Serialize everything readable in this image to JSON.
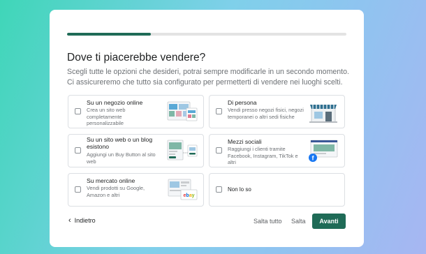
{
  "progress": {
    "value": 0.3
  },
  "header": {
    "title": "Dove ti piacerebbe vendere?",
    "subtitle": "Scegli tutte le opzioni che desideri, potrai sempre modificarle in un secondo momento. Ci assicureremo che tutto sia configurato per permetterti di vendere nei luoghi scelti."
  },
  "options": [
    {
      "title": "Su un negozio online",
      "desc": "Crea un sito web completamente personalizzabile",
      "icon": "online-store-illustration"
    },
    {
      "title": "Di persona",
      "desc": "Vendi presso negozi fisici, negozi temporanei o altri sedi fisiche",
      "icon": "physical-store-illustration"
    },
    {
      "title": "Su un sito web o un blog esistono",
      "desc": "Aggiungi un Buy Button al sito web",
      "icon": "buy-button-illustration"
    },
    {
      "title": "Mezzi sociali",
      "desc": "Raggiungi i clienti tramite Facebook, Instagram, TikTok e altri",
      "icon": "social-media-illustration"
    },
    {
      "title": "Su mercato online",
      "desc": "Vendi prodotti su Google, Amazon e altri",
      "icon": "marketplace-illustration"
    },
    {
      "title": "Non lo so"
    }
  ],
  "footer": {
    "back_label": "Indietro",
    "skip_all_label": "Salta tutto",
    "skip_label": "Salta",
    "next_label": "Avanti"
  },
  "colors": {
    "accent": "#1f6b57",
    "progress_track": "#e3e3e3"
  }
}
